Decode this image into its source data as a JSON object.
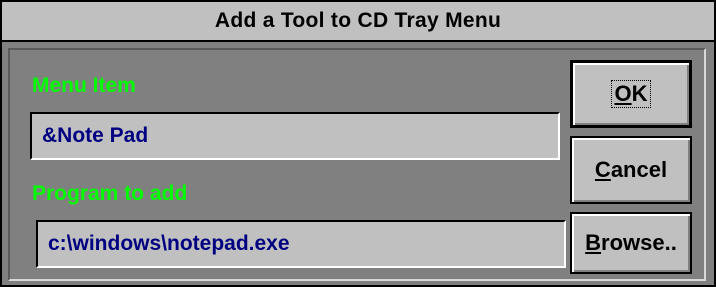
{
  "dialog": {
    "title": "Add a Tool to CD Tray Menu"
  },
  "form": {
    "menu_item_label": "Menu Item",
    "menu_item_value": "&Note Pad",
    "program_label": "Program to add",
    "program_value": "c:\\windows\\notepad.exe"
  },
  "buttons": {
    "ok": {
      "mnemonic": "O",
      "rest": "K"
    },
    "cancel": {
      "mnemonic": "C",
      "rest": "ancel"
    },
    "browse": {
      "mnemonic": "B",
      "rest": "rowse.."
    }
  },
  "colors": {
    "label_color": "#00ff00",
    "field_text_color": "#000080",
    "dialog_background": "#808080",
    "field_background": "#c0c0c0"
  }
}
